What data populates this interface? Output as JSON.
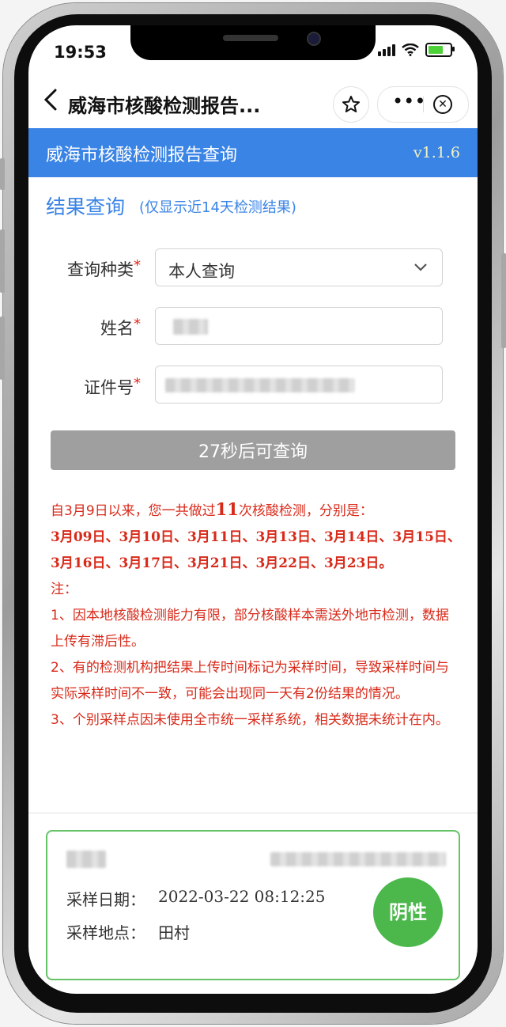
{
  "status_bar": {
    "time": "19:53"
  },
  "nav": {
    "title": "威海市核酸检测报告...",
    "back_icon": "chevron-left-icon",
    "more": "•••"
  },
  "header": {
    "title": "威海市核酸检测报告查询",
    "version": "v1.1.6"
  },
  "section": {
    "title": "结果查询",
    "subtitle": "(仅显示近14天检测结果)"
  },
  "form": {
    "query_type_label": "查询种类",
    "query_type_value": "本人查询",
    "name_label": "姓名",
    "id_label": "证件号",
    "required_mark": "*"
  },
  "query_button": "27秒后可查询",
  "notes": {
    "intro_before": "自3月9日以来，您一共做过",
    "count": "11",
    "intro_after": "次核酸检测，分别是：",
    "dates": "3月09日、3月10日、3月11日、3月13日、3月14日、3月15日、3月16日、3月17日、3月21日、3月22日、3月23日。",
    "note_title": "注：",
    "note1": "1、因本地核酸检测能力有限，部分核酸样本需送外地市检测，数据上传有滞后性。",
    "note2": "2、有的检测机构把结果上传时间标记为采样时间，导致采样时间与实际采样时间不一致，可能会出现同一天有2份结果的情况。",
    "note3": "3、个别采样点因未使用全市统一采样系统，相关数据未统计在内。"
  },
  "result": {
    "date_label": "采样日期：",
    "date_value": "2022-03-22 08:12:25",
    "place_label": "采样地点：",
    "place_value": "田村",
    "status": "阴性"
  },
  "colors": {
    "accent": "#3a84e6",
    "warning": "#d82a1a",
    "negative": "#4cb84c"
  }
}
